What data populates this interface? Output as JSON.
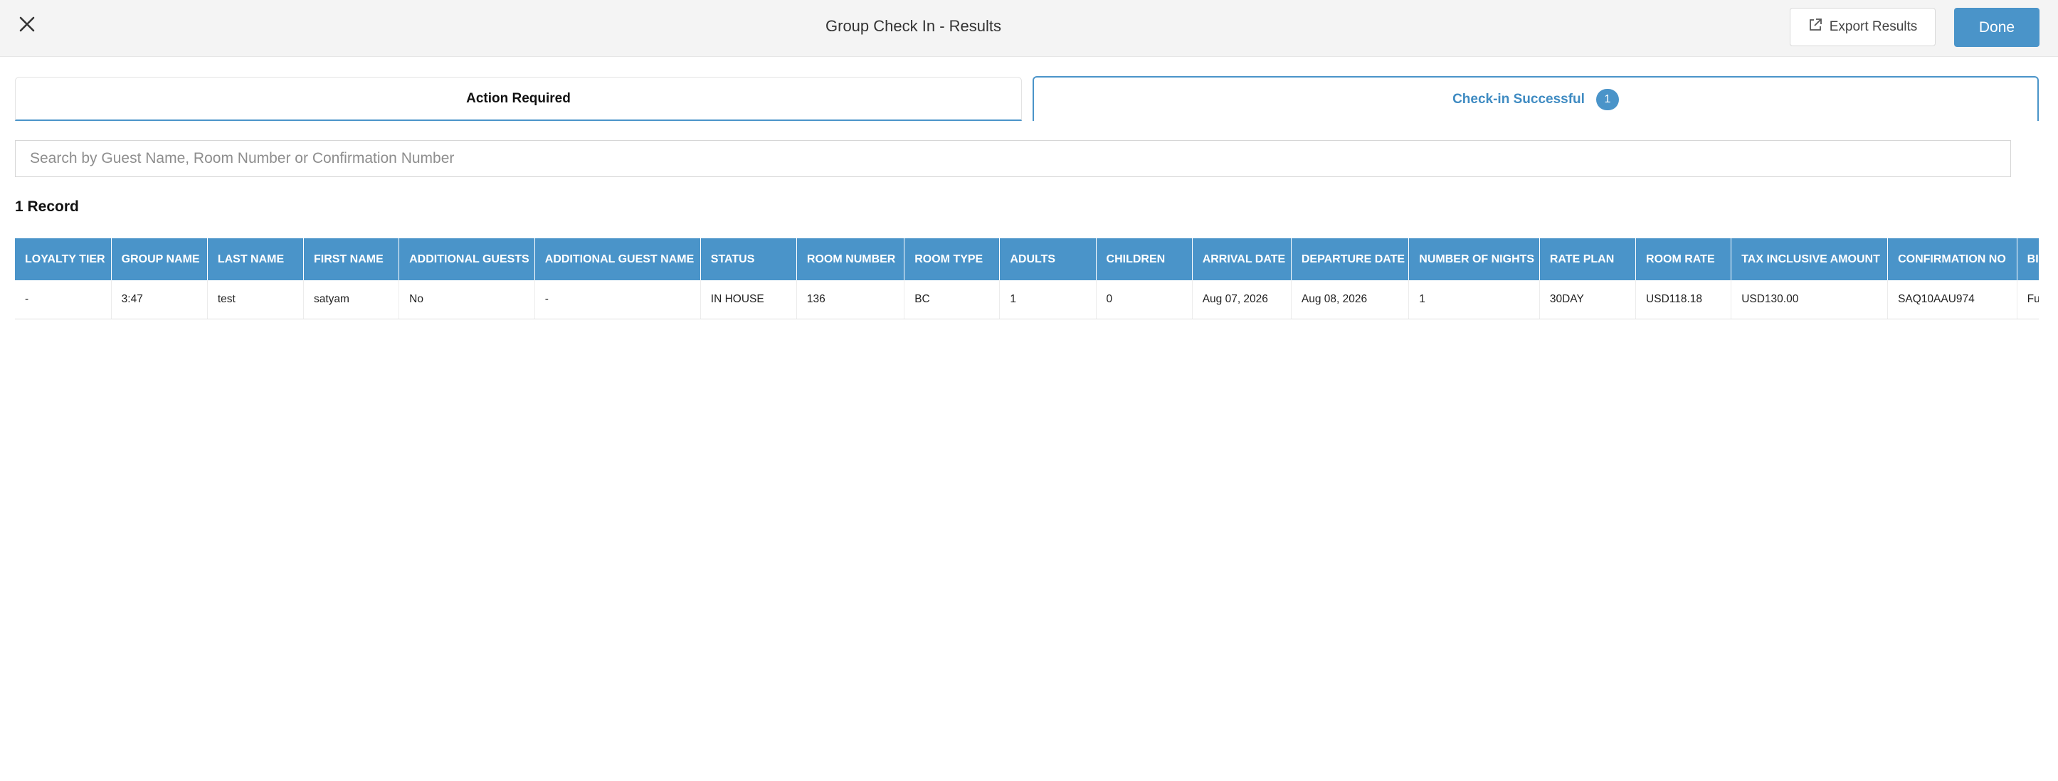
{
  "header": {
    "title": "Group Check In - Results",
    "close_icon": "close-icon",
    "export_label": "Export Results",
    "export_icon": "external-link-icon",
    "done_label": "Done"
  },
  "tabs": [
    {
      "label": "Action Required",
      "active": false
    },
    {
      "label": "Check-in Successful",
      "badge": "1",
      "active": true
    }
  ],
  "search": {
    "placeholder": "Search by Guest Name, Room Number or Confirmation Number",
    "value": ""
  },
  "record_count": "1 Record",
  "table": {
    "columns": [
      "LOYALTY TIER",
      "GROUP NAME",
      "LAST NAME",
      "FIRST NAME",
      "ADDITIONAL GUESTS",
      "ADDITIONAL GUEST NAME",
      "STATUS",
      "ROOM NUMBER",
      "ROOM TYPE",
      "ADULTS",
      "CHILDREN",
      "ARRIVAL DATE",
      "DEPARTURE DATE",
      "NUMBER OF NIGHTS",
      "RATE PLAN",
      "ROOM RATE",
      "TAX INCLUSIVE AMOUNT",
      "CONFIRMATION NO",
      "BILLING"
    ],
    "rows": [
      [
        "-",
        "3:47",
        "test",
        "satyam",
        "No",
        "-",
        "IN HOUSE",
        "136",
        "BC",
        "1",
        "0",
        "Aug 07, 2026",
        "Aug 08, 2026",
        "1",
        "30DAY",
        "USD118.18",
        "USD130.00",
        "SAQ10AAU974",
        "Full Comp"
      ]
    ]
  },
  "colors": {
    "accent": "#4a94c9",
    "topbar_bg": "#f4f4f4"
  }
}
